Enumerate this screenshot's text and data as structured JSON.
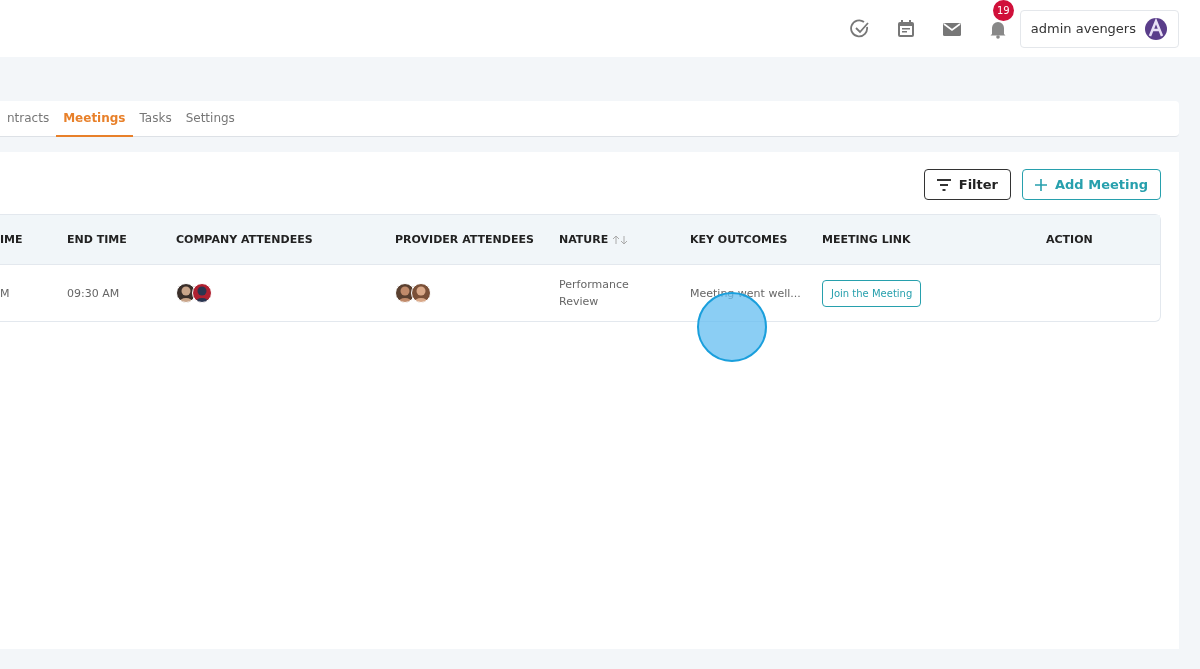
{
  "header": {
    "notification_count": "19",
    "user_name": "admin avengers"
  },
  "tabs": [
    {
      "label": "ntracts",
      "selected": false
    },
    {
      "label": "Meetings",
      "selected": true
    },
    {
      "label": "Tasks",
      "selected": false
    },
    {
      "label": "Settings",
      "selected": false
    }
  ],
  "toolbar": {
    "buttons": [
      {
        "kind": "filter",
        "label": "Filter"
      },
      {
        "kind": "add",
        "label": "Add Meeting"
      }
    ]
  },
  "table": {
    "columns": [
      {
        "label": "IME",
        "sortable": false
      },
      {
        "label": "END TIME",
        "sortable": false
      },
      {
        "label": "COMPANY ATTENDEES",
        "sortable": false
      },
      {
        "label": "PROVIDER ATTENDEES",
        "sortable": false
      },
      {
        "label": "NATURE",
        "sortable": true
      },
      {
        "label": "KEY OUTCOMES",
        "sortable": false
      },
      {
        "label": "MEETING LINK",
        "sortable": false
      },
      {
        "label": "ACTION",
        "sortable": false
      }
    ],
    "rows": [
      {
        "start_time": "M",
        "end_time": "09:30 AM",
        "nature": "Performance Review",
        "key_outcomes": "Meeting went well...",
        "meeting_link": "Join the Meeting"
      }
    ]
  }
}
